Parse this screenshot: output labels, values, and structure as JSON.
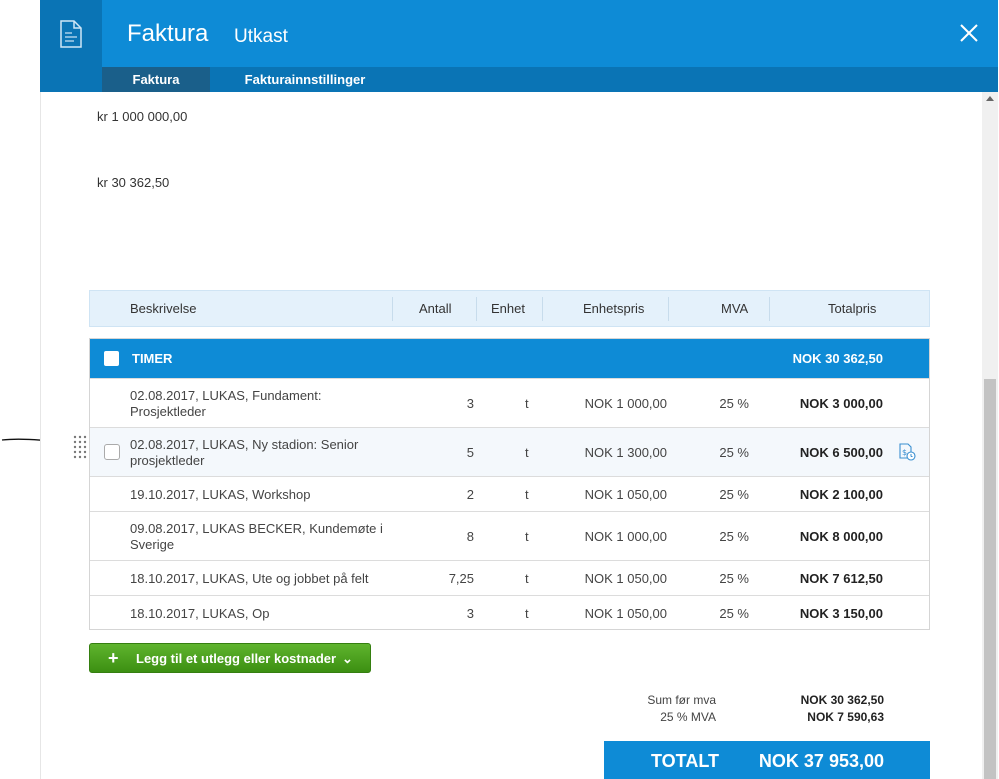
{
  "header": {
    "title": "Faktura",
    "subtitle": "Utkast",
    "tabs": [
      {
        "label": "Faktura"
      },
      {
        "label": "Fakturainnstillinger"
      }
    ]
  },
  "amounts": {
    "first": "kr 1 000 000,00",
    "second": "kr 30 362,50"
  },
  "table": {
    "columns": [
      "Beskrivelse",
      "Antall",
      "Enhet",
      "Enhetspris",
      "MVA",
      "Totalpris"
    ],
    "group": {
      "title": "TIMER",
      "total": "NOK 30 362,50"
    },
    "rows": [
      {
        "desc": "02.08.2017, LUKAS, Fundament: Prosjektleder",
        "qty": "3",
        "unit": "t",
        "price": "NOK 1 000,00",
        "vat": "25 %",
        "total": "NOK 3 000,00"
      },
      {
        "desc": "02.08.2017, LUKAS, Ny stadion: Senior prosjektleder",
        "qty": "5",
        "unit": "t",
        "price": "NOK 1 300,00",
        "vat": "25 %",
        "total": "NOK 6 500,00"
      },
      {
        "desc": "19.10.2017, LUKAS, Workshop",
        "qty": "2",
        "unit": "t",
        "price": "NOK 1 050,00",
        "vat": "25 %",
        "total": "NOK 2 100,00"
      },
      {
        "desc": "09.08.2017, LUKAS BECKER, Kundemøte i Sverige",
        "qty": "8",
        "unit": "t",
        "price": "NOK 1 000,00",
        "vat": "25 %",
        "total": "NOK 8 000,00"
      },
      {
        "desc": "18.10.2017, LUKAS, Ute og jobbet på felt",
        "qty": "7,25",
        "unit": "t",
        "price": "NOK 1 050,00",
        "vat": "25 %",
        "total": "NOK 7 612,50"
      },
      {
        "desc": "18.10.2017, LUKAS, Op",
        "qty": "3",
        "unit": "t",
        "price": "NOK 1 050,00",
        "vat": "25 %",
        "total": "NOK 3 150,00"
      }
    ]
  },
  "add_button": {
    "plus": "+",
    "label": "Legg til et utlegg eller kostnader",
    "chevron": "⌄"
  },
  "summary": {
    "sum_label": "Sum før mva",
    "sum_value": "NOK 30 362,50",
    "vat_label": "25 % MVA",
    "vat_value": "NOK 7 590,63",
    "total_label": "TOTALT",
    "total_value": "NOK 37 953,00"
  },
  "colors": {
    "brand": "#0e8bd6",
    "brand_dark": "#0a74b5",
    "green": "#4aa01f"
  },
  "icons": {
    "header": "invoice-document-icon",
    "close": "close-icon",
    "drag": "drag-handle-icon",
    "row_action": "money-clock-icon"
  }
}
